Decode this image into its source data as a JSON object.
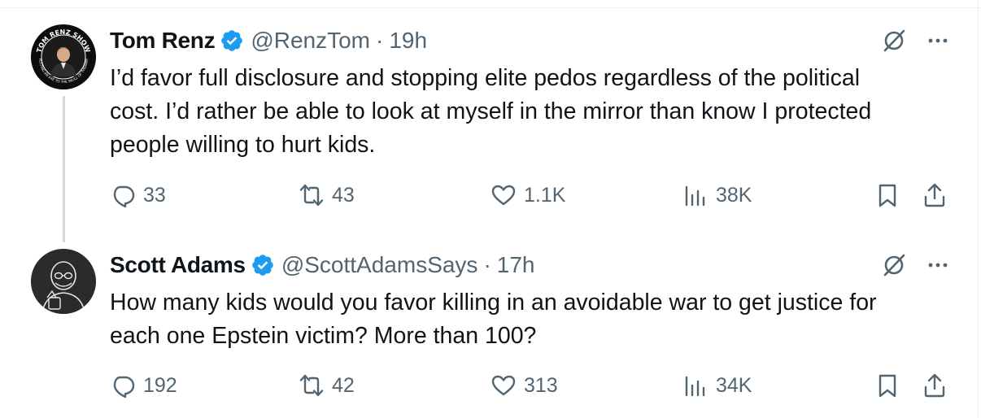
{
  "tweets": [
    {
      "author_name": "Tom Renz",
      "handle": "@RenzTom",
      "separator": "·",
      "time": "19h",
      "avatar_text": "TOM RENZ SHOW · PUTTING AN AXE TO THE SKULL OF TYRANNY",
      "text_lines": [
        "I’d favor full disclosure and stopping elite pedos regardless of the political",
        "cost. I’d rather be able to look at myself in the mirror than know I protected",
        "people willing to hurt kids."
      ],
      "replies": "33",
      "reposts": "43",
      "likes": "1.1K",
      "views": "38K"
    },
    {
      "author_name": "Scott Adams",
      "handle": "@ScottAdamsSays",
      "separator": "·",
      "time": "17h",
      "text_lines": [
        "How many kids would you favor killing in an avoidable war to get justice for",
        "each one Epstein victim? More than 100?"
      ],
      "replies": "192",
      "reposts": "42",
      "likes": "313",
      "views": "34K"
    }
  ],
  "icons": {
    "verified": "verified-badge-icon",
    "grok": "grok-icon",
    "more": "more-dots-icon",
    "reply": "reply-icon",
    "repost": "repost-icon",
    "like": "heart-icon",
    "views": "views-icon",
    "bookmark": "bookmark-icon",
    "share": "share-icon"
  },
  "colors": {
    "verified_blue": "#1d9bf0",
    "text_primary": "#0f1419",
    "text_secondary": "#536471",
    "thread_line": "#cfd9de"
  }
}
